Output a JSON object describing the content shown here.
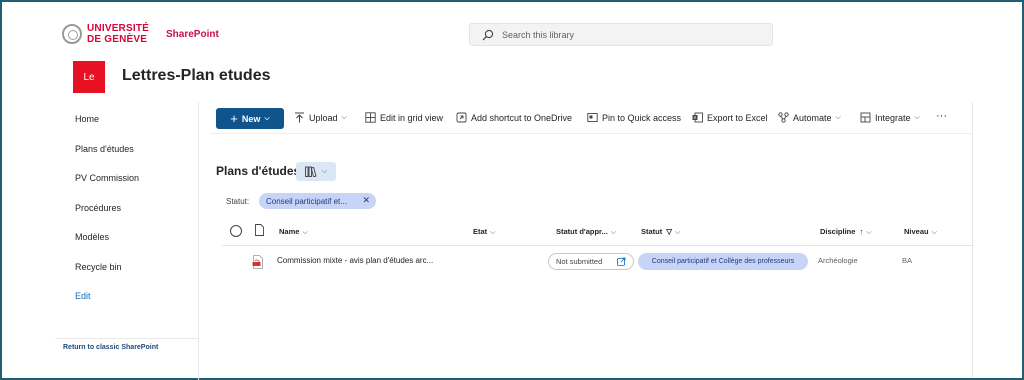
{
  "header": {
    "university_line1": "UNIVERSITÉ",
    "university_line2": "DE GENÈVE",
    "app_name": "SharePoint",
    "search_placeholder": "Search this library",
    "site_initials": "Le",
    "site_name": "Lettres-Plan etudes"
  },
  "nav": {
    "items": [
      "Home",
      "Plans d'études",
      "PV Commission",
      "Procédures",
      "Modèles",
      "Recycle bin"
    ],
    "edit_label": "Edit",
    "return_label": "Return to classic SharePoint"
  },
  "commands": {
    "new": "New",
    "upload": "Upload",
    "edit_grid": "Edit in grid view",
    "add_shortcut": "Add shortcut to OneDrive",
    "pin": "Pin to Quick access",
    "export": "Export to Excel",
    "automate": "Automate",
    "integrate": "Integrate",
    "more": "···"
  },
  "view": {
    "title": "Plans d'études",
    "filter_label": "Statut:",
    "filter_value": "Conseil participatif et..."
  },
  "columns": {
    "name": "Name",
    "etat": "Etat",
    "statut_appr": "Statut d'appr...",
    "statut": "Statut",
    "discipline": "Discipline",
    "niveau": "Niveau"
  },
  "rows": [
    {
      "name": "Commission mixte - avis plan d'études arc...",
      "etat": "",
      "statut_appr": "Not submitted",
      "statut": "Conseil participatif et Collège des professeurs",
      "discipline": "Archéologie",
      "niveau": "BA"
    }
  ],
  "icons": {
    "search": "search-icon",
    "upload": "upload-icon",
    "grid": "grid-view-icon",
    "shortcut": "shortcut-icon",
    "pin": "pin-icon",
    "excel": "excel-icon",
    "automate": "automate-icon",
    "integrate": "integrate-icon",
    "pdf": "pdf-file-icon"
  },
  "colors": {
    "brand_red": "#d5073a",
    "sharepoint_title": "#c5114a",
    "new_button": "#0f548c",
    "site_tile": "#e81123",
    "pill": "#c7d3f7",
    "edit_link": "#0f6cbd"
  }
}
